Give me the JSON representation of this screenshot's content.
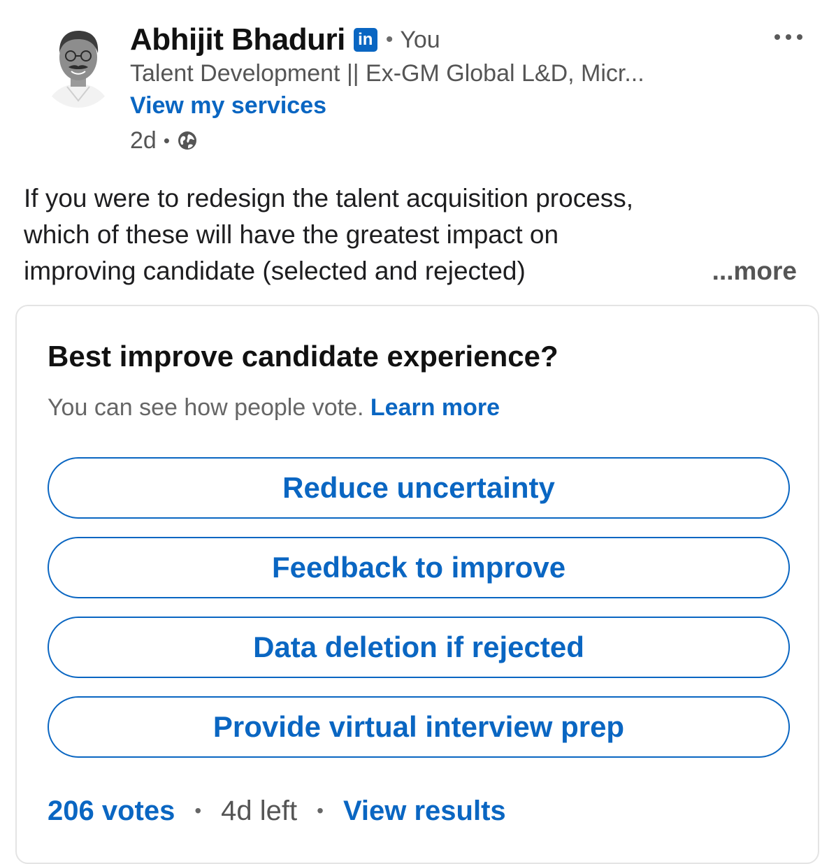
{
  "post": {
    "author": {
      "name": "Abhijit Bhaduri",
      "badge_text": "in",
      "connection": "You",
      "headline": "Talent Development || Ex-GM Global L&D, Micr...",
      "services_link": "View my services",
      "time_ago": "2d"
    },
    "body_lines": [
      "If you were to redesign the talent acquisition process,",
      "which of these will have the greatest impact on",
      "improving candidate (selected and rejected)"
    ],
    "see_more": "...more"
  },
  "poll": {
    "question": "Best improve candidate experience?",
    "visibility_note": "You can see how people vote.",
    "learn_more": "Learn more",
    "options": [
      "Reduce uncertainty",
      "Feedback to improve",
      "Data deletion if rejected",
      "Provide virtual interview prep"
    ],
    "votes": "206 votes",
    "time_left": "4d left",
    "view_results": "View results"
  },
  "colors": {
    "link_blue": "#0a66c2",
    "text_dark": "#111111",
    "text_muted": "#555555",
    "card_border": "#e4e4e4"
  },
  "icons": {
    "avatar": "profile-photo",
    "badge": "linkedin-icon",
    "visibility": "globe-icon",
    "menu": "more-options-icon"
  }
}
